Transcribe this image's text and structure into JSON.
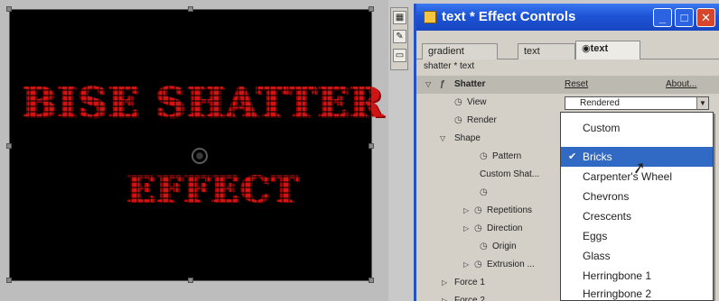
{
  "viewer": {
    "art_line1": "BISE SHATTER",
    "art_line2": "EFFECT"
  },
  "toolbar": {
    "tool1_icon": "grid-icon",
    "tool2_icon": "pen-tool-icon",
    "tool3_icon": "selection-icon"
  },
  "window": {
    "title": "text * Effect Controls",
    "minimize_label": "_",
    "maximize_label": "□",
    "close_label": "✕"
  },
  "tabs": [
    {
      "label": "gradient"
    },
    {
      "label": "text"
    },
    {
      "label": "text"
    }
  ],
  "breadcrumb": "shatter * text",
  "effect": {
    "name": "Shatter",
    "reset_label": "Reset",
    "about_label": "About...",
    "view_value": "Rendered"
  },
  "properties": [
    {
      "label": "View"
    },
    {
      "label": "Render"
    },
    {
      "label": "Shape"
    },
    {
      "label": "Pattern"
    },
    {
      "label": "Custom Shat..."
    },
    {
      "label": ""
    },
    {
      "label": "Repetitions"
    },
    {
      "label": "Direction"
    },
    {
      "label": "Origin"
    },
    {
      "label": "Extrusion ..."
    },
    {
      "label": "Force 1"
    },
    {
      "label": "Force 2"
    }
  ],
  "dropdown": {
    "options": [
      {
        "label": "Custom"
      },
      {
        "label": "Bricks",
        "selected": true
      },
      {
        "label": "Carpenter's Wheel"
      },
      {
        "label": "Chevrons"
      },
      {
        "label": "Crescents"
      },
      {
        "label": "Eggs"
      },
      {
        "label": "Glass"
      },
      {
        "label": "Herringbone 1"
      },
      {
        "label": "Herringbone 2"
      }
    ],
    "check_mark": "✔"
  },
  "colors": {
    "title_bar": "#1d54d6",
    "selection": "#316ac5",
    "art_red": "#d01414"
  }
}
